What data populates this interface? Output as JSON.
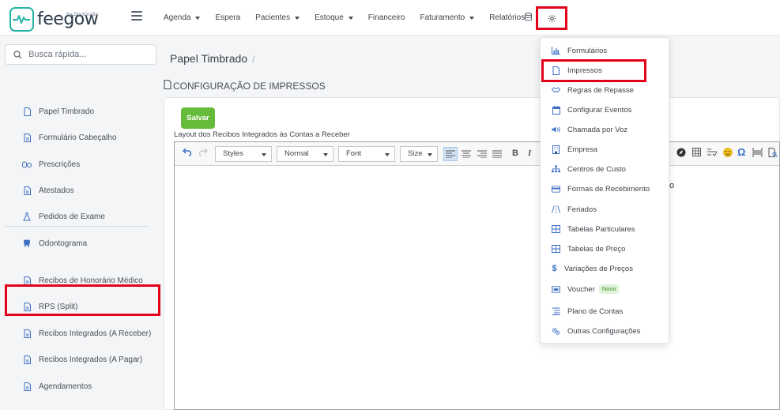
{
  "brand": {
    "name": "feegow",
    "tagline": "by Doctoralia"
  },
  "nav": {
    "items": [
      {
        "label": "Agenda",
        "has_caret": true
      },
      {
        "label": "Espera",
        "has_caret": false
      },
      {
        "label": "Pacientes",
        "has_caret": true
      },
      {
        "label": "Estoque",
        "has_caret": true
      },
      {
        "label": "Financeiro",
        "has_caret": false
      },
      {
        "label": "Faturamento",
        "has_caret": true
      },
      {
        "label": "Relatórios",
        "has_caret": false
      }
    ],
    "icons": [
      "database-icon",
      "gear-icon"
    ]
  },
  "search": {
    "placeholder": "Busca rápida..."
  },
  "sidebar": {
    "group1": [
      {
        "label": "Papel Timbrado",
        "icon": "document-icon"
      },
      {
        "label": "Formulário Cabeçalho",
        "icon": "document-text-icon"
      },
      {
        "label": "Prescrições",
        "icon": "pills-icon"
      },
      {
        "label": "Atestados",
        "icon": "document-text-icon"
      },
      {
        "label": "Pedidos de Exame",
        "icon": "flask-icon"
      },
      {
        "label": "Odontograma",
        "icon": "tooth-icon"
      }
    ],
    "group2": [
      {
        "label": "Recibos de Honorário Médico",
        "icon": "document-text-icon"
      },
      {
        "label": "RPS (Split)",
        "icon": "document-text-icon"
      },
      {
        "label": "Recibos Integrados (A Receber)",
        "icon": "document-text-icon"
      },
      {
        "label": "Recibos Integrados (A Pagar)",
        "icon": "document-text-icon"
      },
      {
        "label": "Agendamentos",
        "icon": "document-text-icon"
      }
    ]
  },
  "breadcrumb": {
    "title": "Papel Timbrado",
    "separator": "/"
  },
  "section": {
    "title": "CONFIGURAÇÃO DE IMPRESSOS"
  },
  "form": {
    "save_label": "Salvar",
    "field_label": "Layout dos Recibos Integrados às Contas a Receber"
  },
  "editor": {
    "styles_label": "Styles",
    "format_label": "Normal",
    "font_label": "Font",
    "size_label": "Size",
    "bold_label": "B",
    "italic_label": "I",
    "omega_label": "Ω",
    "visible_text_fragment": "o"
  },
  "settings_menu": {
    "items": [
      {
        "label": "Formulários",
        "icon": "chart-icon"
      },
      {
        "label": "Impressos",
        "icon": "document-icon"
      },
      {
        "label": "Regras de Repasse",
        "icon": "handshake-icon"
      },
      {
        "label": "Configurar Eventos",
        "icon": "calendar-icon"
      },
      {
        "label": "Chamada por Voz",
        "icon": "volume-icon"
      },
      {
        "label": "Empresa",
        "icon": "building-icon"
      },
      {
        "label": "Centros de Custo",
        "icon": "sitemap-icon"
      },
      {
        "label": "Formas de Recebimento",
        "icon": "credit-card-icon"
      },
      {
        "label": "Feriados",
        "icon": "road-icon"
      },
      {
        "label": "Tabelas Particulares",
        "icon": "table-icon"
      },
      {
        "label": "Tabelas de Preço",
        "icon": "table-icon"
      },
      {
        "label": "Variações de Preços",
        "icon": "dollar-icon"
      },
      {
        "label": "Voucher",
        "icon": "ticket-icon",
        "badge": "Novo"
      },
      {
        "label": "Plano de Contas",
        "icon": "list-icon"
      },
      {
        "label": "Outras Configurações",
        "icon": "gears-icon"
      }
    ]
  },
  "colors": {
    "accent_teal": "#23b3a5",
    "icon_blue": "#3b6fc4",
    "save_green": "#67bb3b",
    "highlight_red": "#e3001b"
  }
}
